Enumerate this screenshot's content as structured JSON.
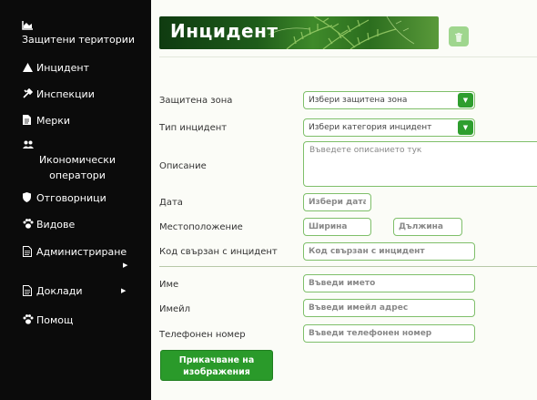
{
  "sidebar": {
    "items": [
      {
        "label": "Защитени територии"
      },
      {
        "label": "Инцидент"
      },
      {
        "label": "Инспекции"
      },
      {
        "label": "Мерки"
      },
      {
        "label_line1": "Икономически",
        "label_line2": "оператори"
      },
      {
        "label": "Отговорници"
      },
      {
        "label": "Видове"
      },
      {
        "label": "Администриране"
      },
      {
        "label": "Доклади"
      },
      {
        "label": "Помощ"
      }
    ]
  },
  "header": {
    "title": "Инцидент"
  },
  "form": {
    "protected_area": {
      "label": "Защитена зона",
      "value": "Избери защитена зона"
    },
    "incident_type": {
      "label": "Тип инцидент",
      "value": "Избери категория инцидент"
    },
    "description": {
      "label": "Описание",
      "placeholder": "Въведете описанието тук"
    },
    "date": {
      "label": "Дата",
      "placeholder": "Избери дата"
    },
    "location": {
      "label": "Местоположение",
      "lat_placeholder": "Ширина",
      "lng_placeholder": "Дължина"
    },
    "incident_code": {
      "label": "Код свързан с инцидент",
      "placeholder": "Код свързан с инцидент"
    },
    "name": {
      "label": "Име",
      "placeholder": "Въведи името"
    },
    "email": {
      "label": "Имейл",
      "placeholder": "Въведи имейл адрес"
    },
    "phone": {
      "label": "Телефонен номер",
      "placeholder": "Въведи телефонен номер"
    },
    "upload_button": {
      "line1": "Прикачване на",
      "line2": "изображения"
    }
  },
  "colors": {
    "sidebar_bg": "#0b0b0b",
    "accent_green": "#2e9e2e",
    "border_green": "#7fbf6a"
  }
}
